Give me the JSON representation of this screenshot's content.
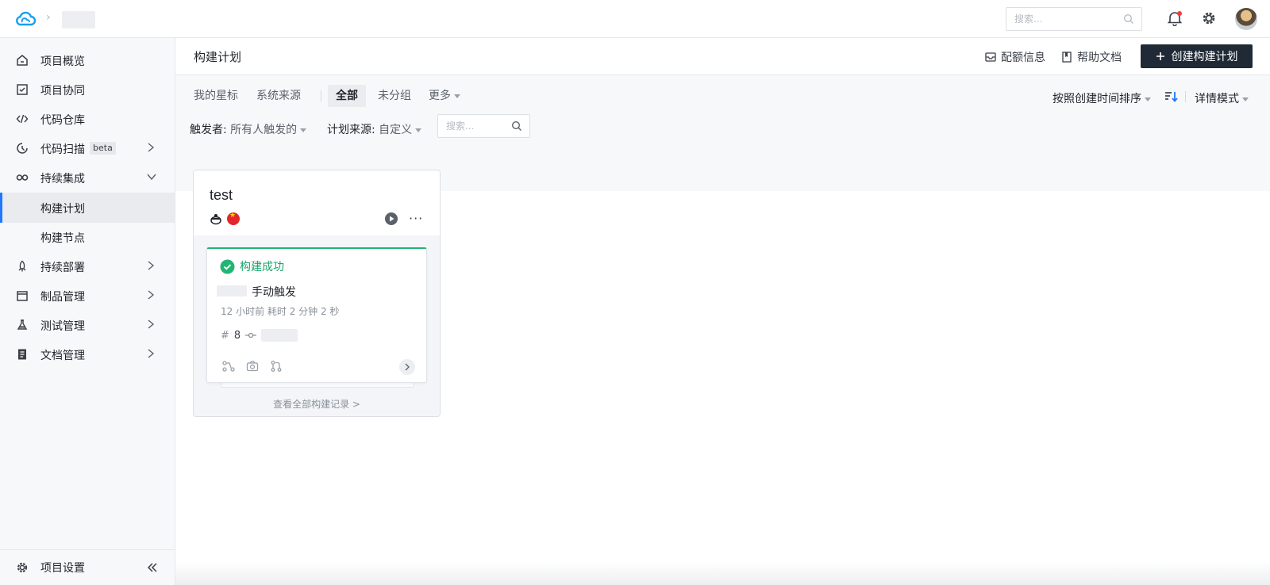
{
  "topbar": {
    "search_placeholder": "搜索..."
  },
  "sidebar": {
    "items": [
      {
        "label": "项目概览",
        "icon": "home-icon"
      },
      {
        "label": "项目协同",
        "icon": "inbox-check-icon"
      },
      {
        "label": "代码仓库",
        "icon": "code-icon"
      },
      {
        "label": "代码扫描",
        "icon": "scan-icon",
        "badge": "beta"
      },
      {
        "label": "持续集成",
        "icon": "infinity-icon"
      },
      {
        "label": "构建计划",
        "active": true
      },
      {
        "label": "构建节点"
      },
      {
        "label": "持续部署",
        "icon": "rocket-icon"
      },
      {
        "label": "制品管理",
        "icon": "package-icon"
      },
      {
        "label": "测试管理",
        "icon": "flask-icon"
      },
      {
        "label": "文档管理",
        "icon": "doc-icon"
      }
    ],
    "footer_label": "项目设置"
  },
  "header": {
    "title": "构建计划",
    "quota_label": "配额信息",
    "help_label": "帮助文档",
    "create_label": "创建构建计划"
  },
  "filters": {
    "tabs": [
      "我的星标",
      "系统来源",
      "全部",
      "未分组",
      "更多"
    ],
    "active_tab": "全部",
    "sort_label": "按照创建时间排序",
    "mode_label": "详情模式",
    "trigger_key": "触发者:",
    "trigger_value": "所有人触发的",
    "source_key": "计划来源:",
    "source_value": "自定义",
    "search_placeholder": "搜索..."
  },
  "plan": {
    "name": "test",
    "latest_build": {
      "status": "构建成功",
      "trigger": "手动触发",
      "meta": "12 小时前 耗时 2 分钟 2 秒",
      "number": "8"
    },
    "view_all_label": "查看全部构建记录 >"
  },
  "colors": {
    "accent": "#1f78ff",
    "success": "#17a568",
    "primary_button": "#1f2a36"
  }
}
